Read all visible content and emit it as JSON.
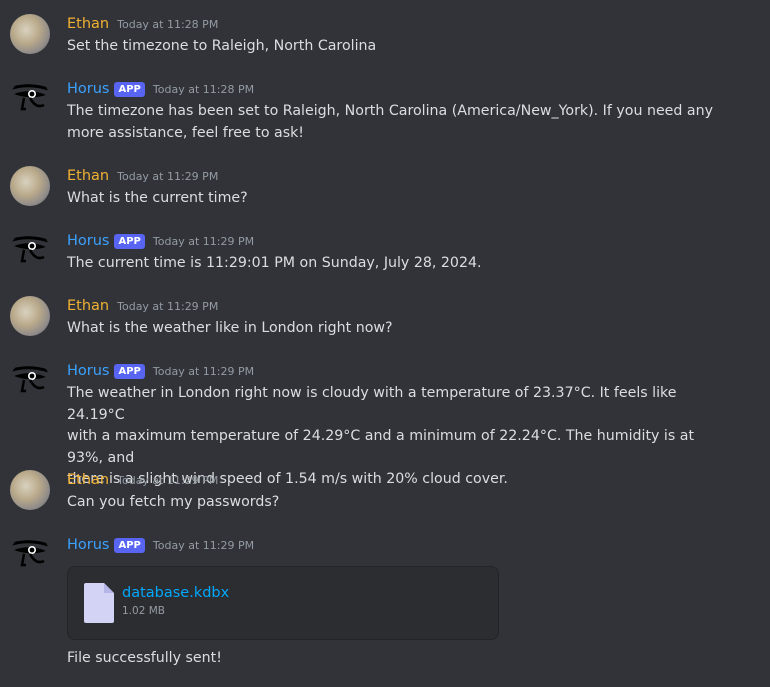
{
  "messages": [
    {
      "author": "Ethan",
      "bot": false,
      "time": "Today at 11:28 PM",
      "text": "Set the timezone to Raleigh, North Carolina"
    },
    {
      "author": "Horus",
      "bot": true,
      "time": "Today at 11:28 PM",
      "text": "The timezone has been set to Raleigh, North Carolina (America/New_York). If you need any\nmore assistance, feel free to ask!"
    },
    {
      "author": "Ethan",
      "bot": false,
      "time": "Today at 11:29 PM",
      "text": "What is the current time?"
    },
    {
      "author": "Horus",
      "bot": true,
      "time": "Today at 11:29 PM",
      "text": "The current time is 11:29:01 PM on Sunday, July 28, 2024."
    },
    {
      "author": "Ethan",
      "bot": false,
      "time": "Today at 11:29 PM",
      "text": "What is the weather like in London right now?"
    },
    {
      "author": "Horus",
      "bot": true,
      "time": "Today at 11:29 PM",
      "text": "The weather in London right now is cloudy with a temperature of 23.37°C. It feels like 24.19°C\nwith a maximum temperature of 24.29°C and a minimum of 22.24°C. The humidity is at 93%, and\nthere is a slight wind speed of 1.54 m/s with 20% cloud cover."
    },
    {
      "author": "Ethan",
      "bot": false,
      "time": "Today at 11:29 PM",
      "text": "Can you fetch my passwords?"
    },
    {
      "author": "Horus",
      "bot": true,
      "time": "Today at 11:29 PM",
      "attachment": {
        "name": "database.kdbx",
        "size": "1.02 MB"
      },
      "text": "File successfully sent!"
    }
  ],
  "app_badge": "APP",
  "colors": {
    "background": "#313338",
    "ethan_name": "#f0b132",
    "horus_name": "#3ba2ff",
    "link": "#00a8fc",
    "badge": "#5865f2"
  }
}
